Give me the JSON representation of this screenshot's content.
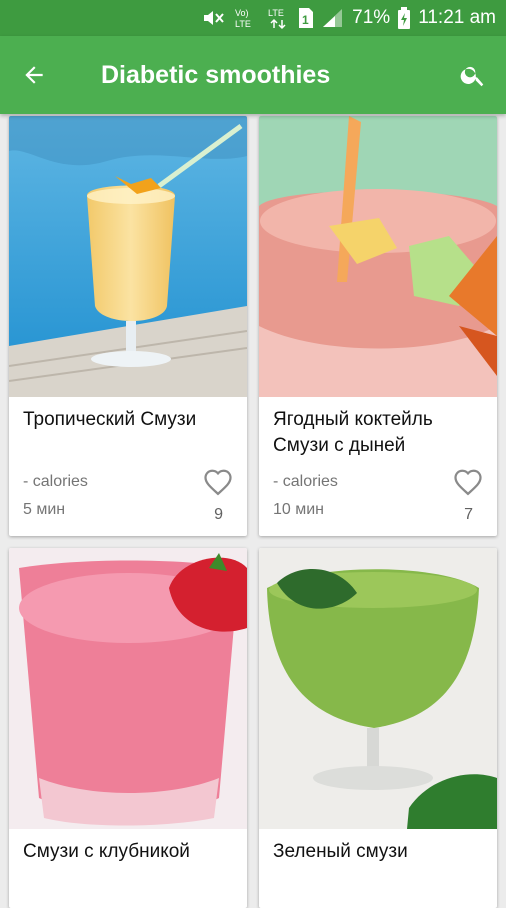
{
  "status_bar": {
    "network": "Vo) LTE",
    "lte": "LTE",
    "sim": "1",
    "battery": "71%",
    "time": "11:21 am"
  },
  "app_bar": {
    "title": "Diabetic smoothies",
    "back_icon": "arrow-back-icon",
    "search_icon": "search-icon"
  },
  "recipes": [
    {
      "name": "Тропический Смузи",
      "calories": "- calories",
      "time": "5 мин",
      "likes": "9"
    },
    {
      "name": "Ягодный коктейль Смузи с дыней",
      "calories": "- calories",
      "time": "10 мин",
      "likes": "7"
    },
    {
      "name": "Смузи с клубникой",
      "calories": "",
      "time": "",
      "likes": ""
    },
    {
      "name": "Зеленый смузи",
      "calories": "",
      "time": "",
      "likes": ""
    }
  ]
}
